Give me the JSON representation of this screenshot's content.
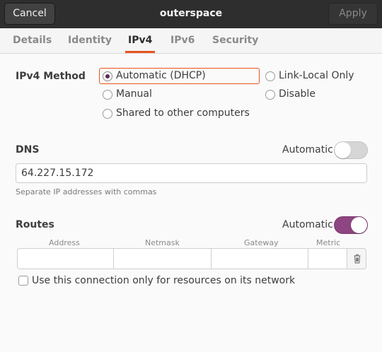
{
  "header": {
    "cancel_label": "Cancel",
    "title": "outerspace",
    "apply_label": "Apply"
  },
  "tabs": [
    {
      "label": "Details",
      "active": false
    },
    {
      "label": "Identity",
      "active": false
    },
    {
      "label": "IPv4",
      "active": true
    },
    {
      "label": "IPv6",
      "active": false
    },
    {
      "label": "Security",
      "active": false
    }
  ],
  "ipv4_method": {
    "label": "IPv4 Method",
    "options": [
      {
        "label": "Automatic (DHCP)",
        "selected": true
      },
      {
        "label": "Link-Local Only",
        "selected": false
      },
      {
        "label": "Manual",
        "selected": false
      },
      {
        "label": "Disable",
        "selected": false
      },
      {
        "label": "Shared to other computers",
        "selected": false
      }
    ]
  },
  "dns": {
    "label": "DNS",
    "automatic_label": "Automatic",
    "automatic_on": false,
    "value": "64.227.15.172",
    "hint": "Separate IP addresses with commas"
  },
  "routes": {
    "label": "Routes",
    "automatic_label": "Automatic",
    "automatic_on": true,
    "columns": [
      "Address",
      "Netmask",
      "Gateway",
      "Metric"
    ],
    "row": [
      "",
      "",
      "",
      ""
    ]
  },
  "only_resources_checkbox": {
    "label": "Use this connection only for resources on its network",
    "checked": false
  },
  "colors": {
    "accent": "#e95420",
    "switch_on": "#8e4581",
    "radio_dot": "#5e2750",
    "headerbar": "#2e2e2e"
  },
  "icons": {
    "delete_route": "trash-icon"
  }
}
